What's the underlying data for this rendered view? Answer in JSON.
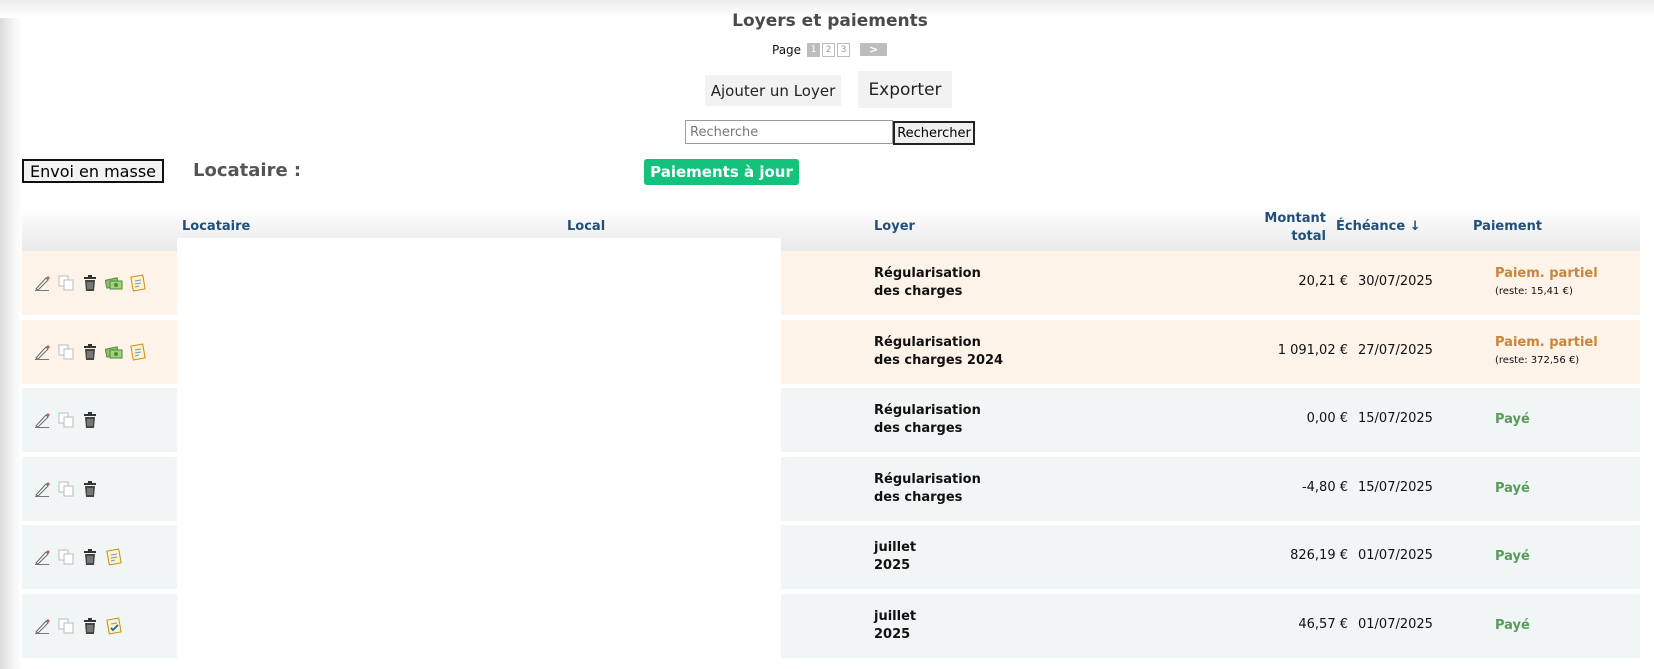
{
  "page": {
    "title": "Loyers et paiements",
    "pager": {
      "label": "Page",
      "pages": [
        "1",
        "2",
        "3"
      ],
      "current": "1",
      "next": ">"
    }
  },
  "toolbar": {
    "add_label": "Ajouter un Loyer",
    "export_label": "Exporter",
    "search_placeholder": "Recherche",
    "search_button": "Rechercher",
    "bulk_label": "Envoi en masse",
    "tenant_label": "Locataire :",
    "status_pill": "Paiements à jour"
  },
  "colors": {
    "pill_green": "#14c27c",
    "partial_orange": "#c8843a",
    "paid_green": "#5a9a5a",
    "header_blue": "#1f4f7b"
  },
  "table": {
    "headers": {
      "locataire": "Locataire",
      "local": "Local",
      "loyer": "Loyer",
      "montant_line1": "Montant",
      "montant_line2": "total",
      "echeance": "Échéance ↓",
      "paiement": "Paiement"
    },
    "rows": [
      {
        "loyer_line1": "Régularisation",
        "loyer_line2": "des charges",
        "montant": "20,21 €",
        "echeance": "30/07/2025",
        "paiement": "Paiem. partiel",
        "remainder": "(reste: 15,41 €)",
        "status": "partial",
        "icons": [
          "edit-icon",
          "copy-icon",
          "trash-icon",
          "payment-icon",
          "receipt-icon"
        ]
      },
      {
        "loyer_line1": "Régularisation",
        "loyer_line2": "des charges 2024",
        "montant": "1 091,02 €",
        "echeance": "27/07/2025",
        "paiement": "Paiem. partiel",
        "remainder": "(reste: 372,56 €)",
        "status": "partial",
        "icons": [
          "edit-icon",
          "copy-icon",
          "trash-icon",
          "payment-icon",
          "receipt-icon"
        ]
      },
      {
        "loyer_line1": "Régularisation",
        "loyer_line2": "des charges",
        "montant": "0,00 €",
        "echeance": "15/07/2025",
        "paiement": "Payé",
        "remainder": "",
        "status": "paid",
        "icons": [
          "edit-icon",
          "copy-icon",
          "trash-icon"
        ]
      },
      {
        "loyer_line1": "Régularisation",
        "loyer_line2": "des charges",
        "montant": "-4,80 €",
        "echeance": "15/07/2025",
        "paiement": "Payé",
        "remainder": "",
        "status": "paid",
        "icons": [
          "edit-icon",
          "copy-icon",
          "trash-icon"
        ]
      },
      {
        "loyer_line1": "juillet",
        "loyer_line2": "2025",
        "montant": "826,19 €",
        "echeance": "01/07/2025",
        "paiement": "Payé",
        "remainder": "",
        "status": "paid",
        "icons": [
          "edit-icon",
          "copy-icon",
          "trash-icon",
          "receipt-icon"
        ]
      },
      {
        "loyer_line1": "juillet",
        "loyer_line2": "2025",
        "montant": "46,57 €",
        "echeance": "01/07/2025",
        "paiement": "Payé",
        "remainder": "",
        "status": "paid",
        "icons": [
          "edit-icon",
          "copy-icon",
          "trash-icon",
          "receipt-checked-icon"
        ]
      }
    ]
  }
}
